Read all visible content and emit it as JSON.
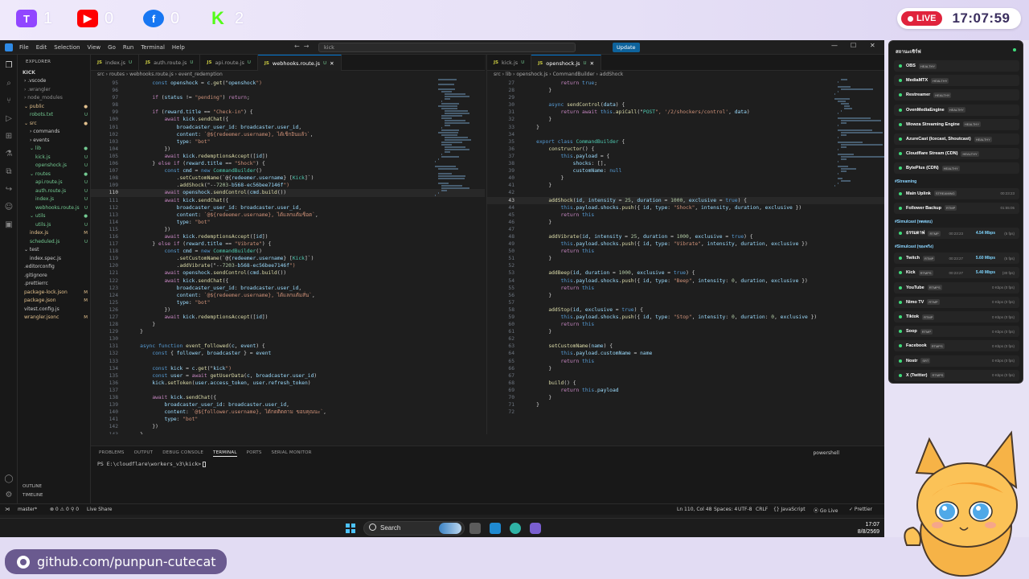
{
  "stream": {
    "stats": [
      {
        "platform": "twitch",
        "icon": "twitch-icon",
        "color": "#9146ff",
        "count": "1"
      },
      {
        "platform": "youtube",
        "icon": "youtube-icon",
        "color": "#ff0000",
        "count": "0"
      },
      {
        "platform": "facebook",
        "icon": "facebook-icon",
        "color": "#1877f2",
        "count": "0"
      },
      {
        "platform": "kick",
        "icon": "kick-icon",
        "color": "#53fc18",
        "count": "2"
      }
    ],
    "live_label": "LIVE",
    "clock": "17:07:59",
    "github": "github.com/punpun-cutecat"
  },
  "vscode": {
    "menu": [
      "File",
      "Edit",
      "Selection",
      "View",
      "Go",
      "Run",
      "Terminal",
      "Help"
    ],
    "search": "kick",
    "update_label": "Update",
    "sidebar": {
      "title": "EXPLORER",
      "root": "KICK",
      "items": [
        {
          "label": "› .vscode",
          "badge": "",
          "indent": 0,
          "color": "#cccccc"
        },
        {
          "label": "› .wrangler",
          "badge": "",
          "indent": 0,
          "color": "#8c8c8c"
        },
        {
          "label": "› node_modules",
          "badge": "",
          "indent": 0,
          "color": "#8c8c8c"
        },
        {
          "label": "⌄ public",
          "badge": "●",
          "indent": 0,
          "color": "#e2c08d"
        },
        {
          "label": "robots.txt",
          "badge": "U",
          "indent": 1,
          "color": "#73c991"
        },
        {
          "label": "⌄ src",
          "badge": "●",
          "indent": 0,
          "color": "#e2c08d"
        },
        {
          "label": "› commands",
          "badge": "",
          "indent": 1,
          "color": "#cccccc"
        },
        {
          "label": "› events",
          "badge": "",
          "indent": 1,
          "color": "#cccccc"
        },
        {
          "label": "⌄ lib",
          "badge": "●",
          "indent": 1,
          "color": "#73c991"
        },
        {
          "label": "kick.js",
          "badge": "U",
          "indent": 2,
          "color": "#73c991"
        },
        {
          "label": "openshock.js",
          "badge": "U",
          "indent": 2,
          "color": "#73c991"
        },
        {
          "label": "⌄ routes",
          "badge": "●",
          "indent": 1,
          "color": "#73c991"
        },
        {
          "label": "api.route.js",
          "badge": "U",
          "indent": 2,
          "color": "#73c991"
        },
        {
          "label": "auth.route.js",
          "badge": "U",
          "indent": 2,
          "color": "#73c991"
        },
        {
          "label": "index.js",
          "badge": "U",
          "indent": 2,
          "color": "#73c991"
        },
        {
          "label": "webhooks.route.js",
          "badge": "U",
          "indent": 2,
          "color": "#73c991"
        },
        {
          "label": "⌄ utils",
          "badge": "●",
          "indent": 1,
          "color": "#73c991"
        },
        {
          "label": "utils.js",
          "badge": "U",
          "indent": 2,
          "color": "#73c991"
        },
        {
          "label": "index.js",
          "badge": "M",
          "indent": 1,
          "color": "#e2c08d"
        },
        {
          "label": "scheduled.js",
          "badge": "U",
          "indent": 1,
          "color": "#73c991"
        },
        {
          "label": "⌄ test",
          "badge": "",
          "indent": 0,
          "color": "#cccccc"
        },
        {
          "label": "index.spec.js",
          "badge": "",
          "indent": 1,
          "color": "#cccccc"
        },
        {
          "label": ".editorconfig",
          "badge": "",
          "indent": 0,
          "color": "#cccccc"
        },
        {
          "label": ".gitignore",
          "badge": "",
          "indent": 0,
          "color": "#cccccc"
        },
        {
          "label": ".prettierrc",
          "badge": "",
          "indent": 0,
          "color": "#cccccc"
        },
        {
          "label": "package-lock.json",
          "badge": "M",
          "indent": 0,
          "color": "#e2c08d"
        },
        {
          "label": "package.json",
          "badge": "M",
          "indent": 0,
          "color": "#e2c08d"
        },
        {
          "label": "vitest.config.js",
          "badge": "",
          "indent": 0,
          "color": "#cccccc"
        },
        {
          "label": "wrangler.jsonc",
          "badge": "M",
          "indent": 0,
          "color": "#e2c08d"
        }
      ],
      "outline": "OUTLINE",
      "timeline": "TIMELINE"
    },
    "left_editor": {
      "tabs": [
        {
          "label": "index.js",
          "mod": "U",
          "active": false
        },
        {
          "label": "auth.route.js",
          "mod": "U",
          "active": false
        },
        {
          "label": "api.route.js",
          "mod": "U",
          "active": false
        },
        {
          "label": "webhooks.route.js",
          "mod": "U",
          "active": true
        }
      ],
      "breadcrumb": "src › routes › webhooks.route.js › event_redemption",
      "lines": [
        {
          "n": "95",
          "t": "        const openshock = c.get(\"openshock\")"
        },
        {
          "n": "96",
          "t": ""
        },
        {
          "n": "97",
          "t": "        if (status != \"pending\") return;"
        },
        {
          "n": "98",
          "t": ""
        },
        {
          "n": "99",
          "t": "        if (reward.title == \"Check-in\") {"
        },
        {
          "n": "100",
          "t": "            await kick.sendChat({"
        },
        {
          "n": "101",
          "t": "                broadcaster_user_id: broadcaster.user_id,"
        },
        {
          "n": "102",
          "t": "                content: `@${redeemer.username}, ได้เช็กอินแล้ว`,"
        },
        {
          "n": "103",
          "t": "                type: \"bot\""
        },
        {
          "n": "104",
          "t": "            })"
        },
        {
          "n": "105",
          "t": "            await kick.redemptionsAccept([id])"
        },
        {
          "n": "106",
          "t": "        } else if (reward.title == \"Shock\") {"
        },
        {
          "n": "107",
          "t": "            const cmd = new CommandBuilder()"
        },
        {
          "n": "108",
          "t": "                .setCustomName(`@${redeemer.username} [Kick]`)"
        },
        {
          "n": "109",
          "t": "                .addShock(\"019df93d-7e0a-7203-b568-ec56bee7146f\")"
        },
        {
          "n": "110",
          "t": "            await openshock.sendControl(cmd.build())"
        },
        {
          "n": "111",
          "t": "            await kick.sendChat({"
        },
        {
          "n": "112",
          "t": "                broadcaster_user_id: broadcaster.user_id,"
        },
        {
          "n": "113",
          "t": "                content: `@${redeemer.username}, ได้แลกแต้มช็อต`,"
        },
        {
          "n": "114",
          "t": "                type: \"bot\""
        },
        {
          "n": "115",
          "t": "            })"
        },
        {
          "n": "116",
          "t": "            await kick.redemptionsAccept([id])"
        },
        {
          "n": "117",
          "t": "        } else if (reward.title == \"Vibrate\") {"
        },
        {
          "n": "118",
          "t": "            const cmd = new CommandBuilder()"
        },
        {
          "n": "119",
          "t": "                .setCustomName(`@${redeemer.username} [Kick]`)"
        },
        {
          "n": "120",
          "t": "                .addVibrate(\"019df93d-7e0a-7203-b568-ec56bee7146f\")"
        },
        {
          "n": "121",
          "t": "            await openshock.sendControl(cmd.build())"
        },
        {
          "n": "122",
          "t": "            await kick.sendChat({"
        },
        {
          "n": "123",
          "t": "                broadcaster_user_id: broadcaster.user_id,"
        },
        {
          "n": "124",
          "t": "                content: `@${redeemer.username}, ได้แลกแต้มสั่น`,"
        },
        {
          "n": "125",
          "t": "                type: \"bot\""
        },
        {
          "n": "126",
          "t": "            })"
        },
        {
          "n": "127",
          "t": "            await kick.redemptionsAccept([id])"
        },
        {
          "n": "128",
          "t": "        }"
        },
        {
          "n": "129",
          "t": "    }"
        },
        {
          "n": "130",
          "t": ""
        },
        {
          "n": "131",
          "t": "    async function event_followed(c, event) {"
        },
        {
          "n": "132",
          "t": "        const { follower, broadcaster } = event"
        },
        {
          "n": "133",
          "t": ""
        },
        {
          "n": "134",
          "t": "        const kick = c.get(\"kick\")"
        },
        {
          "n": "135",
          "t": "        const user = await getUserData(c, broadcaster.user_id)"
        },
        {
          "n": "136",
          "t": "        kick.setToken(user.access_token, user.refresh_token)"
        },
        {
          "n": "137",
          "t": ""
        },
        {
          "n": "138",
          "t": "        await kick.sendChat({"
        },
        {
          "n": "139",
          "t": "            broadcaster_user_id: broadcaster.user_id,"
        },
        {
          "n": "140",
          "t": "            content: `@${follower.username}, ได้กดติดตาม ขอบคุณนะ`,"
        },
        {
          "n": "141",
          "t": "            type: \"bot\""
        },
        {
          "n": "142",
          "t": "        })"
        },
        {
          "n": "143",
          "t": "    }"
        },
        {
          "n": "144",
          "t": ""
        }
      ]
    },
    "right_editor": {
      "tabs": [
        {
          "label": "kick.js",
          "mod": "U",
          "active": false
        },
        {
          "label": "openshock.js",
          "mod": "U",
          "active": true
        }
      ],
      "breadcrumb": "src › lib › openshock.js › CommandBuilder › addShock",
      "lines": [
        {
          "n": "27",
          "t": "            return true;"
        },
        {
          "n": "28",
          "t": "        }"
        },
        {
          "n": "29",
          "t": ""
        },
        {
          "n": "30",
          "t": "        async sendControl(data) {"
        },
        {
          "n": "31",
          "t": "            return await this.apiCall(\"POST\", '/2/shockers/control', data)"
        },
        {
          "n": "32",
          "t": "        }"
        },
        {
          "n": "33",
          "t": "    }"
        },
        {
          "n": "34",
          "t": ""
        },
        {
          "n": "35",
          "t": "    export class CommandBuilder {"
        },
        {
          "n": "36",
          "t": "        constructor() {"
        },
        {
          "n": "37",
          "t": "            this.payload = {"
        },
        {
          "n": "38",
          "t": "                shocks: [],"
        },
        {
          "n": "39",
          "t": "                customName: null"
        },
        {
          "n": "40",
          "t": "            }"
        },
        {
          "n": "41",
          "t": "        }"
        },
        {
          "n": "42",
          "t": ""
        },
        {
          "n": "43",
          "t": "        addShock(id, intensity = 25, duration = 1000, exclusive = true) {"
        },
        {
          "n": "44",
          "t": "            this.payload.shocks.push({ id, type: \"Shock\", intensity, duration, exclusive })"
        },
        {
          "n": "45",
          "t": "            return this"
        },
        {
          "n": "46",
          "t": "        }"
        },
        {
          "n": "47",
          "t": ""
        },
        {
          "n": "48",
          "t": "        addVibrate(id, intensity = 25, duration = 1000, exclusive = true) {"
        },
        {
          "n": "49",
          "t": "            this.payload.shocks.push({ id, type: \"Vibrate\", intensity, duration, exclusive })"
        },
        {
          "n": "50",
          "t": "            return this"
        },
        {
          "n": "51",
          "t": "        }"
        },
        {
          "n": "52",
          "t": ""
        },
        {
          "n": "53",
          "t": "        addBeep(id, duration = 1000, exclusive = true) {"
        },
        {
          "n": "54",
          "t": "            this.payload.shocks.push({ id, type: \"Beep\", intensity: 0, duration, exclusive })"
        },
        {
          "n": "55",
          "t": "            return this"
        },
        {
          "n": "56",
          "t": "        }"
        },
        {
          "n": "57",
          "t": ""
        },
        {
          "n": "58",
          "t": "        addStop(id, exclusive = true) {"
        },
        {
          "n": "59",
          "t": "            this.payload.shocks.push({ id, type: \"Stop\", intensity: 0, duration: 0, exclusive })"
        },
        {
          "n": "60",
          "t": "            return this"
        },
        {
          "n": "61",
          "t": "        }"
        },
        {
          "n": "62",
          "t": ""
        },
        {
          "n": "63",
          "t": "        setCustomName(name) {"
        },
        {
          "n": "64",
          "t": "            this.payload.customName = name"
        },
        {
          "n": "65",
          "t": "            return this"
        },
        {
          "n": "66",
          "t": "        }"
        },
        {
          "n": "67",
          "t": ""
        },
        {
          "n": "68",
          "t": "        build() {"
        },
        {
          "n": "69",
          "t": "            return this.payload"
        },
        {
          "n": "70",
          "t": "        }"
        },
        {
          "n": "71",
          "t": "    }"
        },
        {
          "n": "72",
          "t": ""
        }
      ]
    },
    "panel": {
      "tabs": [
        "PROBLEMS",
        "OUTPUT",
        "DEBUG CONSOLE",
        "TERMINAL",
        "PORTS",
        "SERIAL MONITOR"
      ],
      "active_tab": "TERMINAL",
      "prompt": "PS E:\\cloudflare\\workers_v3\\kick>",
      "shell": "powershell"
    },
    "status": {
      "branch": "master*",
      "problems": "⊗ 0 ⚠ 0",
      "ports": "⚲ 0",
      "live_share": "Live Share",
      "position": "Ln 110, Col 48",
      "spaces": "Spaces: 4",
      "encoding": "UTF-8",
      "eol": "CRLF",
      "language": "{} JavaScript",
      "golive": "⦿ Go Live",
      "prettier": "✓ Prettier"
    }
  },
  "taskbar": {
    "search_label": "Search",
    "time": "17:07",
    "date": "8/8/2569"
  },
  "status_panel": {
    "title": "สถานะเซิร์ฟ",
    "services": [
      {
        "name": "OBS",
        "tag": "HEALTHY"
      },
      {
        "name": "MediaMTX",
        "tag": "HEALTHY"
      },
      {
        "name": "Restreamer",
        "tag": "HEALTHY"
      },
      {
        "name": "OvenMediaEngine",
        "tag": "HEALTHY"
      },
      {
        "name": "Wowza Streaming Engine",
        "tag": "HEALTHY"
      },
      {
        "name": "AzureCast (Icecast, Shoutcast)",
        "tag": "HEALTHY"
      },
      {
        "name": "Cloudflare Stream (CDN)",
        "tag": "HEALTHY"
      },
      {
        "name": "BytePlus (CDN)",
        "tag": "HEALTHY"
      }
    ],
    "streaming_head": "#Streaming",
    "streaming": [
      {
        "name": "Main Uplink",
        "tag": "STREAMING",
        "right": "00:23:23"
      },
      {
        "name": "Follower Backup",
        "tag": "RTMP",
        "right": "01:55:05"
      }
    ],
    "simulcast_head_1": "#Simulcast (ทดสอบ)",
    "simulcast_1": [
      {
        "name": "ธรรมดาฟ",
        "tag": "RTMP",
        "time": "00:23:23",
        "rate": "4.54 Mbps",
        "extra": "(5 fps)"
      }
    ],
    "simulcast_head_2": "#Simulcast (ของจริง)",
    "simulcast_2": [
      {
        "name": "Twitch",
        "tag": "RTMP",
        "time": "00:23:27",
        "rate": "5.60 Mbps",
        "extra": "(5 fps)"
      },
      {
        "name": "Kick",
        "tag": "RTMPS",
        "time": "00:23:27",
        "rate": "5.40 Mbps",
        "extra": "(30 fps)"
      },
      {
        "name": "YouTube",
        "tag": "RTMPS",
        "time": "",
        "rate": "",
        "extra": "0 Kbps  (0 fps)"
      },
      {
        "name": "Nimo TV",
        "tag": "RTMP",
        "time": "",
        "rate": "",
        "extra": "0 Kbps  (0 fps)"
      },
      {
        "name": "Tiktok",
        "tag": "RTMP",
        "time": "",
        "rate": "",
        "extra": "0 Kbps  (0 fps)"
      },
      {
        "name": "Soop",
        "tag": "RTMP",
        "time": "",
        "rate": "",
        "extra": "0 Kbps  (0 fps)"
      },
      {
        "name": "Facebook",
        "tag": "RTMPS",
        "time": "",
        "rate": "",
        "extra": "0 Kbps  (0 fps)"
      },
      {
        "name": "Nostr",
        "tag": "SRT",
        "time": "",
        "rate": "",
        "extra": "0 Kbps  (0 fps)"
      },
      {
        "name": "X (Twitter)",
        "tag": "RTMPS",
        "time": "",
        "rate": "",
        "extra": "0 Kbps  (0 fps)"
      }
    ]
  }
}
